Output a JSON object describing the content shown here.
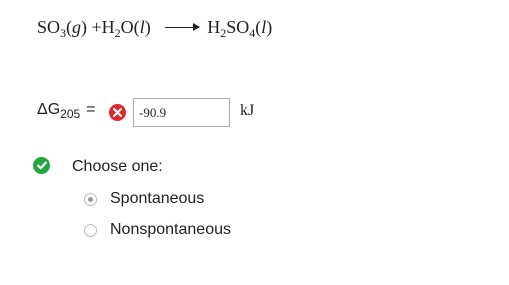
{
  "equation": {
    "reactant1_formula": "SO",
    "reactant1_sub": "3",
    "reactant1_phase": "g",
    "plus": "+",
    "reactant2_h": "H",
    "reactant2_sub": "2",
    "reactant2_o": "O",
    "reactant2_phase": "l",
    "product_h": "H",
    "product_h_sub": "2",
    "product_so": "SO",
    "product_so_sub": "4",
    "product_phase": "l"
  },
  "delta_g": {
    "symbol": "ΔG",
    "subscript": "205",
    "equals": "=",
    "value": "-90.9",
    "unit": "kJ",
    "status": "incorrect"
  },
  "choice": {
    "prompt": "Choose one:",
    "status": "correct",
    "options": [
      {
        "label": "Spontaneous",
        "selected": true
      },
      {
        "label": "Nonspontaneous",
        "selected": false
      }
    ]
  },
  "colors": {
    "error": "#e0262d",
    "success": "#22a63b"
  }
}
